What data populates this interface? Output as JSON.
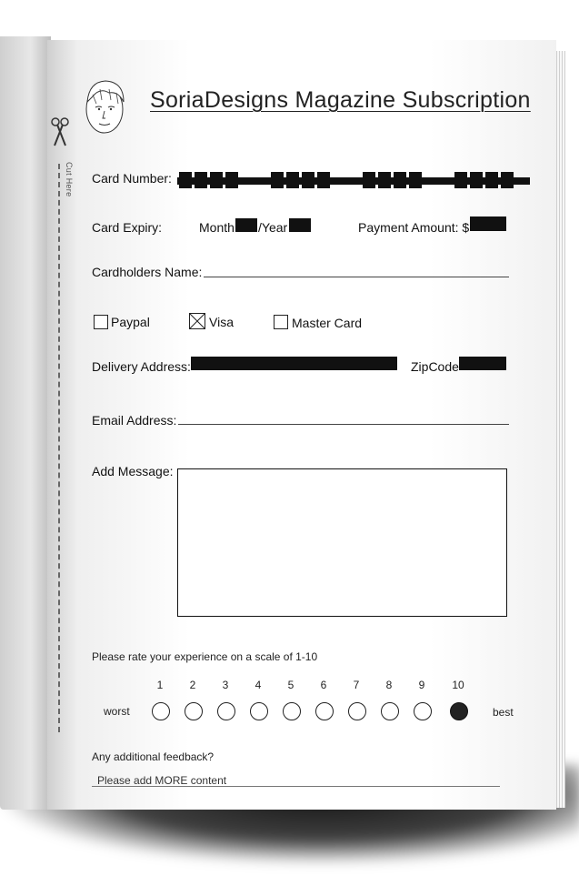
{
  "title": "SoriaDesigns Magazine Subscription",
  "cut_here": "Cut Here",
  "form": {
    "card_number_label": "Card Number:",
    "card_expiry_label": "Card Expiry:",
    "month_label": "Month",
    "year_label": "/Year",
    "payment_amount_label": "Payment Amount: $",
    "cardholder_label": "Cardholders Name:",
    "payment_options": [
      {
        "label": "Paypal",
        "checked": false
      },
      {
        "label": "Visa",
        "checked": true
      },
      {
        "label": "Master Card",
        "checked": false
      }
    ],
    "delivery_label": "Delivery Address:",
    "zip_label": "ZipCode",
    "email_label": "Email Address:",
    "message_label": "Add Message:"
  },
  "rating": {
    "prompt": "Please rate your experience on a scale of 1-10",
    "scale": [
      "1",
      "2",
      "3",
      "4",
      "5",
      "6",
      "7",
      "8",
      "9",
      "10"
    ],
    "worst_label": "worst",
    "best_label": "best",
    "selected": 10
  },
  "feedback": {
    "prompt": "Any additional feedback?",
    "value": "Please add MORE content"
  }
}
